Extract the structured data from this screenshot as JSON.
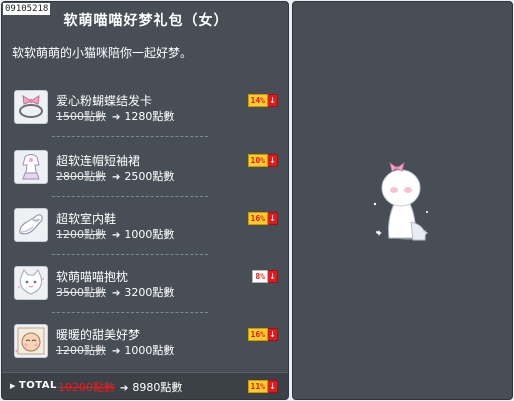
{
  "item_code": "09105218",
  "title": "软萌喵喵好梦礼包（女）",
  "subtitle": "软软萌萌的小猫咪陪你一起好梦。",
  "items": [
    {
      "name": "爱心粉蝴蝶结发卡",
      "old_price": "1500點數",
      "new_price": "1280點數",
      "discount": "14%",
      "icon": "pink-bow-hairpin-icon",
      "discount_style": "gold"
    },
    {
      "name": "超软连帽短袖裙",
      "old_price": "2800點數",
      "new_price": "2500點數",
      "discount": "10%",
      "icon": "hooded-dress-icon",
      "discount_style": "gold"
    },
    {
      "name": "超软室内鞋",
      "old_price": "1200點數",
      "new_price": "1000點數",
      "discount": "16%",
      "icon": "slipper-icon",
      "discount_style": "gold"
    },
    {
      "name": "软萌喵喵抱枕",
      "old_price": "3500點數",
      "new_price": "3200點數",
      "discount": "8%",
      "icon": "cat-pillow-icon",
      "discount_style": "white"
    },
    {
      "name": "暖暖的甜美好梦",
      "old_price": "1200點數",
      "new_price": "1000點數",
      "discount": "16%",
      "icon": "sweet-dream-face-icon",
      "discount_style": "gold"
    }
  ],
  "total": {
    "label": "TOTAL",
    "old_price": "10200點數",
    "new_price": "8980點數",
    "discount": "11%"
  },
  "colors": {
    "panel_bg": "#474e56",
    "discount_gold": "#ffcc2a",
    "discount_red": "#d81e1e",
    "total_old_red": "#e81c1c"
  }
}
